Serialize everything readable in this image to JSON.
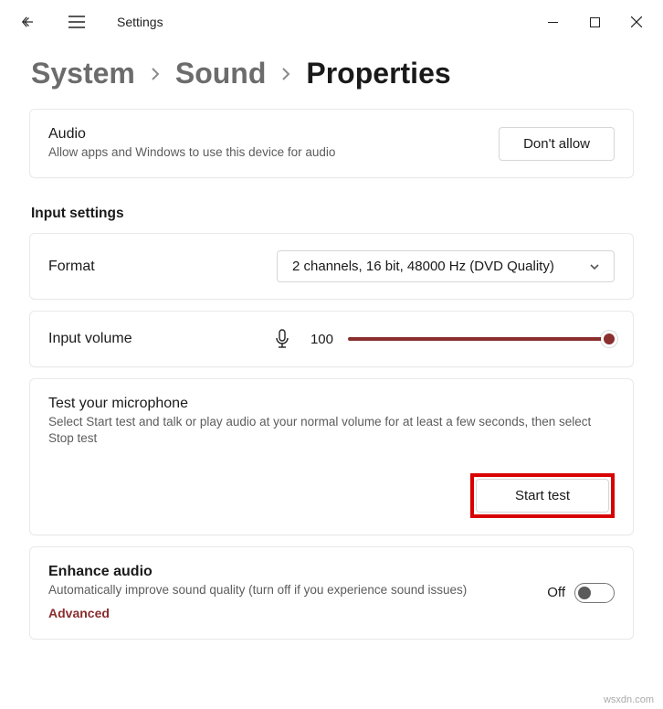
{
  "titlebar": {
    "title": "Settings"
  },
  "breadcrumb": {
    "items": [
      "System",
      "Sound"
    ],
    "current": "Properties"
  },
  "audio": {
    "title": "Audio",
    "subtitle": "Allow apps and Windows to use this device for audio",
    "button": "Don't allow"
  },
  "section_header": "Input settings",
  "format": {
    "label": "Format",
    "value": "2 channels, 16 bit, 48000 Hz (DVD Quality)"
  },
  "volume": {
    "label": "Input volume",
    "value": "100"
  },
  "test": {
    "title": "Test your microphone",
    "subtitle": "Select Start test and talk or play audio at your normal volume for at least a few seconds, then select Stop test",
    "button": "Start test"
  },
  "enhance": {
    "title": "Enhance audio",
    "subtitle": "Automatically improve sound quality (turn off if you experience sound issues)",
    "advanced": "Advanced",
    "toggle_state": "Off"
  },
  "watermark": "wsxdn.com"
}
